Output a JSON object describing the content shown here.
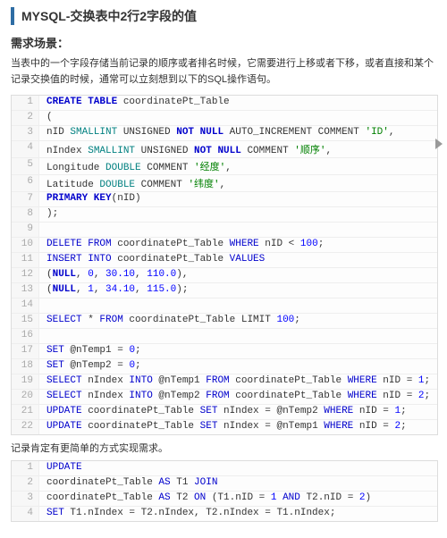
{
  "title": "MYSQL-交换表中2行2字段的值",
  "h_scene": "需求场景：",
  "scene_text": "当表中的一个字段存储当前记录的顺序或者排名时候，它需要进行上移或者下移，或者直接和某个记录交换值的时候，通常可以立刻想到以下的SQL操作语句。",
  "note": "记录肯定有更简单的方式实现需求。",
  "code1": [
    [
      {
        "t": "CREATE TABLE",
        "c": "kw"
      },
      {
        "t": " coordinatePt_Table"
      }
    ],
    [
      {
        "t": "("
      }
    ],
    [
      {
        "t": "nID "
      },
      {
        "t": "SMALLINT",
        "c": "ty"
      },
      {
        "t": " UNSIGNED "
      },
      {
        "t": "NOT NULL",
        "c": "kw"
      },
      {
        "t": " AUTO_INCREMENT COMMENT "
      },
      {
        "t": "'ID'",
        "c": "str"
      },
      {
        "t": ","
      }
    ],
    [
      {
        "t": "nIndex "
      },
      {
        "t": "SMALLINT",
        "c": "ty"
      },
      {
        "t": " UNSIGNED "
      },
      {
        "t": "NOT NULL",
        "c": "kw"
      },
      {
        "t": " COMMENT "
      },
      {
        "t": "'顺序'",
        "c": "str"
      },
      {
        "t": ","
      }
    ],
    [
      {
        "t": "Longitude "
      },
      {
        "t": "DOUBLE",
        "c": "ty"
      },
      {
        "t": " COMMENT "
      },
      {
        "t": "'经度'",
        "c": "str"
      },
      {
        "t": ","
      }
    ],
    [
      {
        "t": "Latitude "
      },
      {
        "t": "DOUBLE",
        "c": "ty"
      },
      {
        "t": " COMMENT "
      },
      {
        "t": "'纬度'",
        "c": "str"
      },
      {
        "t": ","
      }
    ],
    [
      {
        "t": "PRIMARY KEY",
        "c": "kw"
      },
      {
        "t": "(nID)"
      }
    ],
    [
      {
        "t": ");"
      }
    ],
    [],
    [
      {
        "t": "DELETE FROM",
        "c": "sql"
      },
      {
        "t": " coordinatePt_Table "
      },
      {
        "t": "WHERE",
        "c": "sql"
      },
      {
        "t": " nID < "
      },
      {
        "t": "100",
        "c": "num"
      },
      {
        "t": ";"
      }
    ],
    [
      {
        "t": "INSERT INTO",
        "c": "sql"
      },
      {
        "t": " coordinatePt_Table "
      },
      {
        "t": "VALUES",
        "c": "sql"
      }
    ],
    [
      {
        "t": "("
      },
      {
        "t": "NULL",
        "c": "kw"
      },
      {
        "t": ", "
      },
      {
        "t": "0",
        "c": "num"
      },
      {
        "t": ", "
      },
      {
        "t": "30.10",
        "c": "num"
      },
      {
        "t": ", "
      },
      {
        "t": "110.0",
        "c": "num"
      },
      {
        "t": "),"
      }
    ],
    [
      {
        "t": "("
      },
      {
        "t": "NULL",
        "c": "kw"
      },
      {
        "t": ", "
      },
      {
        "t": "1",
        "c": "num"
      },
      {
        "t": ", "
      },
      {
        "t": "34.10",
        "c": "num"
      },
      {
        "t": ", "
      },
      {
        "t": "115.0",
        "c": "num"
      },
      {
        "t": ");"
      }
    ],
    [],
    [
      {
        "t": "SELECT",
        "c": "sql"
      },
      {
        "t": " * "
      },
      {
        "t": "FROM",
        "c": "sql"
      },
      {
        "t": " coordinatePt_Table LIMIT "
      },
      {
        "t": "100",
        "c": "num"
      },
      {
        "t": ";"
      }
    ],
    [],
    [
      {
        "t": "SET",
        "c": "sql"
      },
      {
        "t": " @nTemp1 = "
      },
      {
        "t": "0",
        "c": "num"
      },
      {
        "t": ";"
      }
    ],
    [
      {
        "t": "SET",
        "c": "sql"
      },
      {
        "t": " @nTemp2 = "
      },
      {
        "t": "0",
        "c": "num"
      },
      {
        "t": ";"
      }
    ],
    [
      {
        "t": "SELECT",
        "c": "sql"
      },
      {
        "t": " nIndex "
      },
      {
        "t": "INTO",
        "c": "sql"
      },
      {
        "t": " @nTemp1 "
      },
      {
        "t": "FROM",
        "c": "sql"
      },
      {
        "t": " coordinatePt_Table "
      },
      {
        "t": "WHERE",
        "c": "sql"
      },
      {
        "t": " nID = "
      },
      {
        "t": "1",
        "c": "num"
      },
      {
        "t": ";"
      }
    ],
    [
      {
        "t": "SELECT",
        "c": "sql"
      },
      {
        "t": " nIndex "
      },
      {
        "t": "INTO",
        "c": "sql"
      },
      {
        "t": " @nTemp2 "
      },
      {
        "t": "FROM",
        "c": "sql"
      },
      {
        "t": " coordinatePt_Table "
      },
      {
        "t": "WHERE",
        "c": "sql"
      },
      {
        "t": " nID = "
      },
      {
        "t": "2",
        "c": "num"
      },
      {
        "t": ";"
      }
    ],
    [
      {
        "t": "UPDATE",
        "c": "sql"
      },
      {
        "t": " coordinatePt_Table "
      },
      {
        "t": "SET",
        "c": "sql"
      },
      {
        "t": " nIndex = @nTemp2 "
      },
      {
        "t": "WHERE",
        "c": "sql"
      },
      {
        "t": " nID = "
      },
      {
        "t": "1",
        "c": "num"
      },
      {
        "t": ";"
      }
    ],
    [
      {
        "t": "UPDATE",
        "c": "sql"
      },
      {
        "t": " coordinatePt_Table "
      },
      {
        "t": "SET",
        "c": "sql"
      },
      {
        "t": " nIndex = @nTemp1 "
      },
      {
        "t": "WHERE",
        "c": "sql"
      },
      {
        "t": " nID = "
      },
      {
        "t": "2",
        "c": "num"
      },
      {
        "t": ";"
      }
    ]
  ],
  "code2": [
    [
      {
        "t": "UPDATE",
        "c": "sql"
      }
    ],
    [
      {
        "t": "coordinatePt_Table "
      },
      {
        "t": "AS",
        "c": "sql"
      },
      {
        "t": " T1 "
      },
      {
        "t": "JOIN",
        "c": "sql"
      }
    ],
    [
      {
        "t": "coordinatePt_Table "
      },
      {
        "t": "AS",
        "c": "sql"
      },
      {
        "t": " T2 "
      },
      {
        "t": "ON",
        "c": "sql"
      },
      {
        "t": " (T1.nID = "
      },
      {
        "t": "1",
        "c": "num"
      },
      {
        "t": " "
      },
      {
        "t": "AND",
        "c": "sql"
      },
      {
        "t": " T2.nID = "
      },
      {
        "t": "2",
        "c": "num"
      },
      {
        "t": ")"
      }
    ],
    [
      {
        "t": "SET",
        "c": "sql"
      },
      {
        "t": " T1.nIndex = T2.nIndex, T2.nIndex = T1.nIndex;"
      }
    ]
  ]
}
